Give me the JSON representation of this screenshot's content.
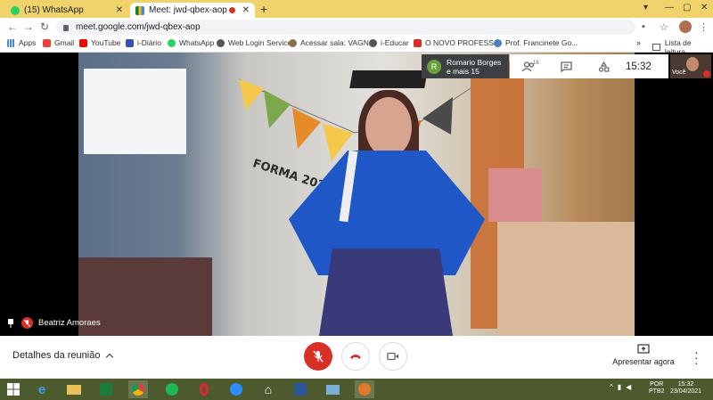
{
  "browser": {
    "tabs": [
      {
        "title": "(15) WhatsApp",
        "icon": "whatsapp-icon",
        "active": false
      },
      {
        "title": "Meet: jwd-qbex-aop",
        "icon": "meet-icon",
        "active": true,
        "recording": true
      }
    ],
    "url": "meet.google.com/jwd-qbex-aop",
    "bookmarks": [
      {
        "label": "Apps",
        "icon": "apps-grid-icon"
      },
      {
        "label": "Gmail",
        "icon": "gmail-icon"
      },
      {
        "label": "YouTube",
        "icon": "youtube-icon"
      },
      {
        "label": "i-Diário",
        "icon": "idiario-icon"
      },
      {
        "label": "WhatsApp",
        "icon": "whatsapp-icon"
      },
      {
        "label": "Web Login Service",
        "icon": "globe-icon"
      },
      {
        "label": "Acessar sala: VAGN...",
        "icon": "class-icon"
      },
      {
        "label": "i-Educar",
        "icon": "globe-icon"
      },
      {
        "label": "O NOVO PROFESS...",
        "icon": "doc-icon"
      },
      {
        "label": "Prof. Francinete Go...",
        "icon": "site-icon"
      }
    ],
    "more_bookmarks": "»",
    "reading_list": "Lista de leitura"
  },
  "meet": {
    "presenter_chip": {
      "avatar_letter": "R",
      "line1": "Romario Borges",
      "line2": "e mais 15"
    },
    "people_count": "16",
    "clock": "15:32",
    "self_label": "Você",
    "participant_name": "Beatriz Amoraes",
    "video_text": "FORMA 2020",
    "meeting_details": "Detalhes da reunião",
    "present_now": "Apresentar agora"
  },
  "taskbar": {
    "language": [
      "POR",
      "PTB2"
    ],
    "time": "15:32",
    "date": "23/04/2021"
  }
}
